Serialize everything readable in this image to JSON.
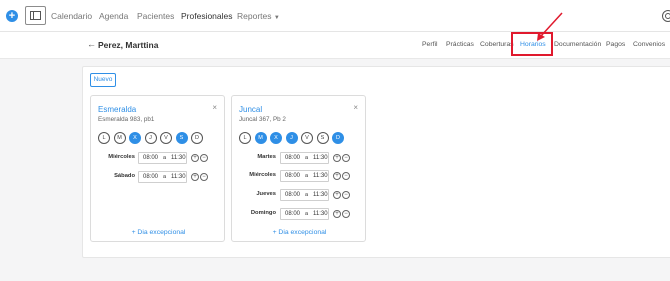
{
  "nav": {
    "items": [
      {
        "label": "Calendario",
        "active": false
      },
      {
        "label": "Agenda",
        "active": false
      },
      {
        "label": "Pacientes",
        "active": false
      },
      {
        "label": "Profesionales",
        "active": true
      },
      {
        "label": "Reportes",
        "active": false,
        "dropdown": true
      }
    ],
    "add_icon": "+"
  },
  "patient": {
    "name": "Perez, Marttina"
  },
  "tabs": [
    {
      "label": "Perfil",
      "active": false
    },
    {
      "label": "Prácticas",
      "active": false
    },
    {
      "label": "Coberturas",
      "active": false
    },
    {
      "label": "Horarios",
      "active": true
    },
    {
      "label": "Documentación",
      "active": false
    },
    {
      "label": "Pagos",
      "active": false
    },
    {
      "label": "Convenios",
      "active": false
    }
  ],
  "new_button": "Nuevo",
  "cards": [
    {
      "title": "Esmeralda",
      "address": "Esmeralda 983, pb1",
      "days": [
        {
          "letter": "L",
          "on": false
        },
        {
          "letter": "M",
          "on": false
        },
        {
          "letter": "X",
          "on": true
        },
        {
          "letter": "J",
          "on": false
        },
        {
          "letter": "V",
          "on": false
        },
        {
          "letter": "S",
          "on": true
        },
        {
          "letter": "D",
          "on": false
        }
      ],
      "slots": [
        {
          "day": "Miércoles",
          "from": "08:00",
          "sep": "a",
          "to": "11:30"
        },
        {
          "day": "Sábado",
          "from": "08:00",
          "sep": "a",
          "to": "11:30"
        }
      ],
      "exceptional": "+ Dia excepcional"
    },
    {
      "title": "Juncal",
      "address": "Juncal 367, Pb 2",
      "days": [
        {
          "letter": "L",
          "on": false
        },
        {
          "letter": "M",
          "on": true
        },
        {
          "letter": "X",
          "on": true
        },
        {
          "letter": "J",
          "on": true
        },
        {
          "letter": "V",
          "on": false
        },
        {
          "letter": "S",
          "on": false
        },
        {
          "letter": "D",
          "on": true
        }
      ],
      "slots": [
        {
          "day": "Martes",
          "from": "08:00",
          "sep": "a",
          "to": "11:30"
        },
        {
          "day": "Miércoles",
          "from": "08:00",
          "sep": "a",
          "to": "11:30"
        },
        {
          "day": "Jueves",
          "from": "08:00",
          "sep": "a",
          "to": "11:30"
        },
        {
          "day": "Domingo",
          "from": "08:00",
          "sep": "a",
          "to": "11:30"
        }
      ],
      "exceptional": "+ Dia excepcional"
    }
  ],
  "icons": {
    "close": "×",
    "add": "+",
    "remove": "−",
    "back": "←"
  },
  "colors": {
    "accent": "#2f8fe6",
    "annotation": "#e0192d"
  }
}
